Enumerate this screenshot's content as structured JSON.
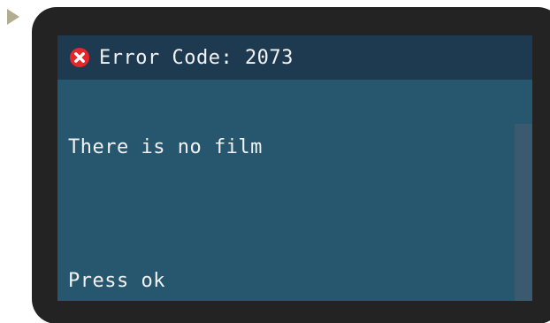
{
  "dialog": {
    "title": "Error Code: 2073",
    "message": "There is no film",
    "prompt": "Press ok"
  },
  "icons": {
    "marker": "play-triangle-icon",
    "status": "error-x-icon"
  },
  "colors": {
    "device_bezel": "#232323",
    "screen_background": "#26576e",
    "title_bar": "#1e3a51",
    "error_icon": "#e5262b",
    "text": "#f2f2f2",
    "marker": "#b3ad90"
  }
}
